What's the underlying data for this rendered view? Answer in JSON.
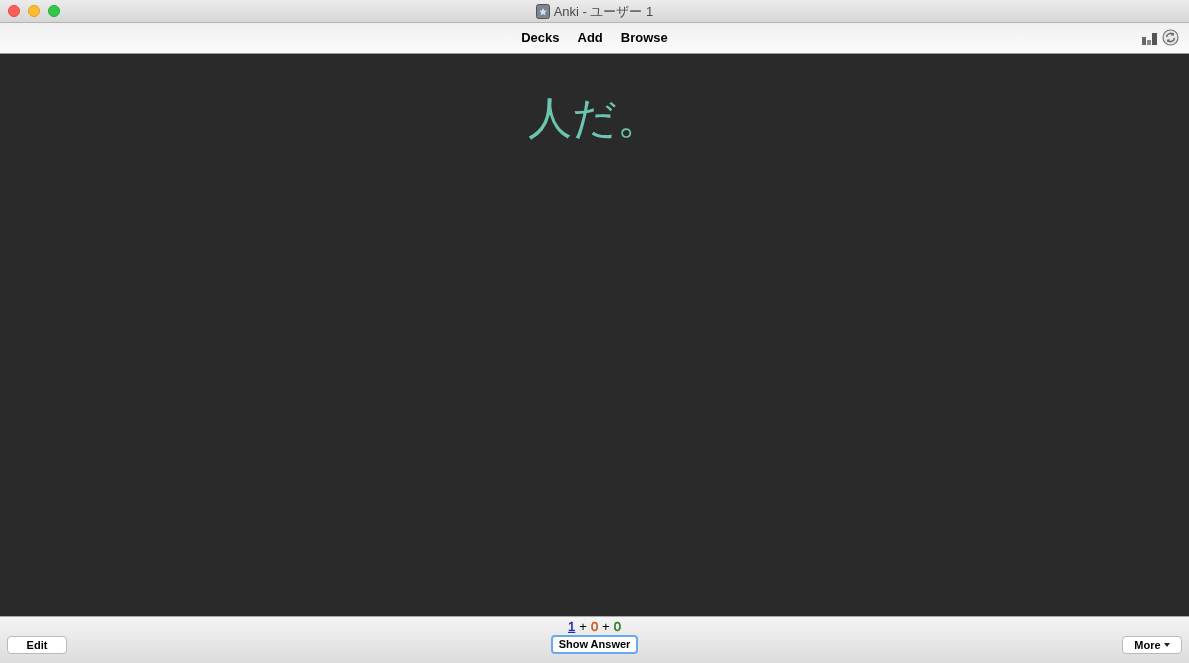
{
  "window": {
    "title": "Anki - ユーザー 1"
  },
  "toolbar": {
    "links": [
      "Decks",
      "Add",
      "Browse"
    ]
  },
  "card": {
    "text": "人だ。"
  },
  "bottom_bar": {
    "counts": [
      {
        "value": "1",
        "color": "#1f2bb0",
        "current": true
      },
      {
        "value": "0",
        "color": "#c35617",
        "current": false
      },
      {
        "value": "0",
        "color": "#237a1f",
        "current": false
      }
    ],
    "separator": "+",
    "edit_button": "Edit",
    "show_answer_button": "Show Answer",
    "more_button": "More"
  }
}
